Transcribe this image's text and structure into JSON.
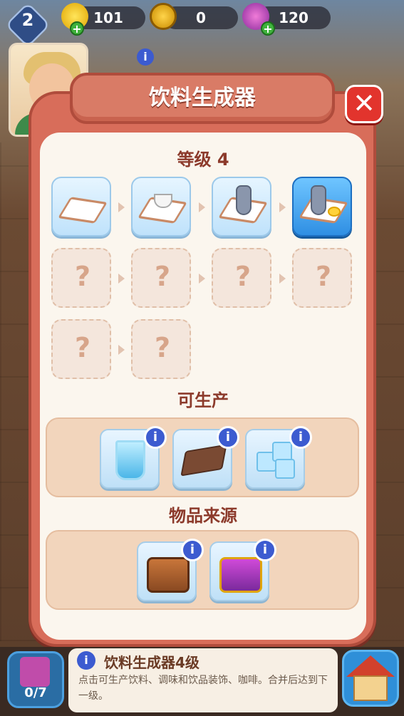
{
  "hud": {
    "level": "2",
    "energy": "101",
    "coins": "0",
    "gems": "120"
  },
  "modal": {
    "title": "饮料生成器",
    "level_label": "等级 4",
    "produce_label": "可生产",
    "source_label": "物品来源",
    "chain_visible_tiers": 4,
    "chain_locked_tiers": 6
  },
  "produce_items": [
    "water-glass",
    "coffee-pouch",
    "ice-cubes"
  ],
  "source_items": [
    "brown-chest",
    "purple-chest"
  ],
  "bottom": {
    "inventory_count": "0/7",
    "title": "饮料生成器4级",
    "description": "点击可生产饮料、调味和饮品装饰、咖啡。合并后达到下一级。"
  },
  "colors": {
    "modal_frame": "#d86d5a",
    "panel": "#fbf6ee",
    "section_text": "#8c3a2b",
    "active_tile": "#2f8fe3",
    "info_blue": "#3c5bd0",
    "close_red": "#e2342d"
  }
}
